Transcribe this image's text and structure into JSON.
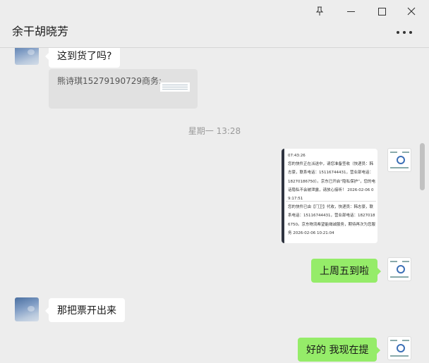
{
  "window": {
    "title": "余干胡晓芳",
    "pin_icon": "pin-icon",
    "min_icon": "minimize-icon",
    "max_icon": "maximize-icon",
    "close_icon": "close-icon",
    "more_icon": "more-icon"
  },
  "messages": {
    "m1": "这到货了吗?",
    "m2_card": "熊诗琪15279190729商务:",
    "timestamp": "星期一 13:28",
    "image_text_1": "07:43:26",
    "image_text_2": "您的快件正在派送中，请您准备签收（快递员：韩志豪，联系电话：15116744431，营业部电话：18270186750）。京东已开启“隐私保护”，您的电话隐私不会被泄露，请放心接听！ 2026-02-06 09:17:51",
    "image_text_3": "您的快件已由【门卫】代收，快递员：韩志豪，联系电话：15116744431，营业部电话：18270186750。京东物流希望能竭诚服务，期待再次为您服务 2026-02-06 10:21:04",
    "m3": "上周五到啦",
    "m4": "那把票开出来",
    "m5": "好的 我现在提"
  }
}
